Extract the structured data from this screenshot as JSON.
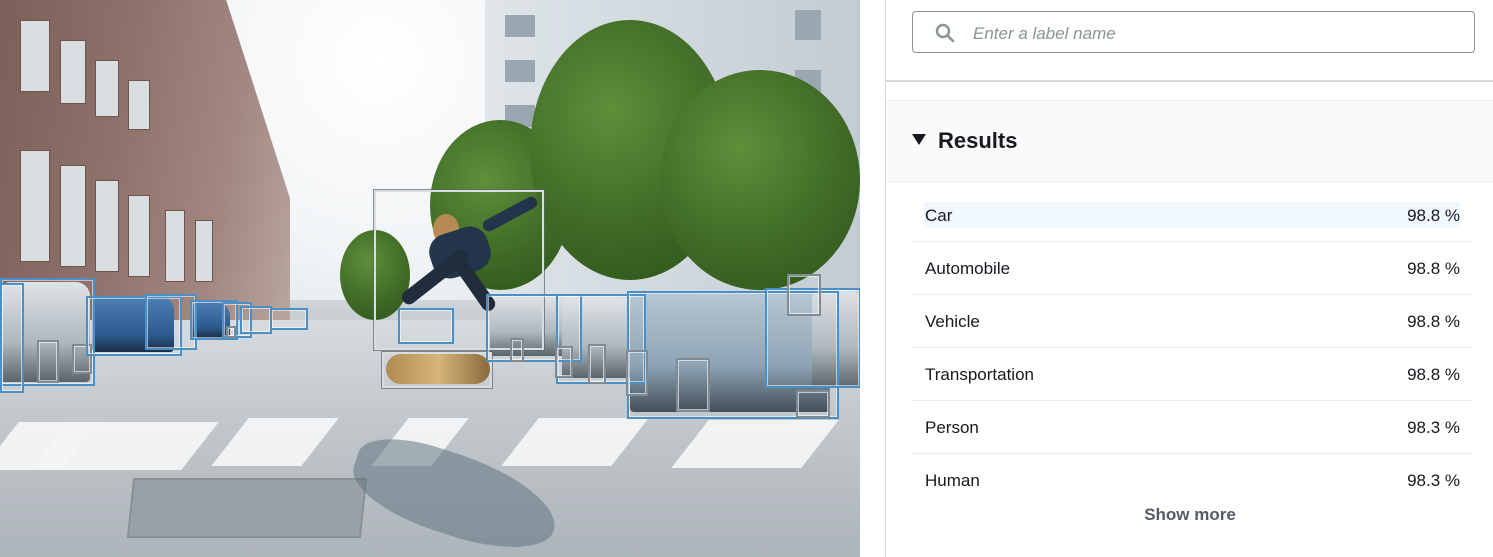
{
  "image": {
    "description_icon": "street-scene-photo"
  },
  "search": {
    "placeholder": "Enter a label name",
    "value": "",
    "icon": "search-icon"
  },
  "results": {
    "title": "Results",
    "toggle_icon": "caret-down-icon",
    "items": [
      {
        "label": "Car",
        "confidence": "98.8 %"
      },
      {
        "label": "Automobile",
        "confidence": "98.8 %"
      },
      {
        "label": "Vehicle",
        "confidence": "98.8 %"
      },
      {
        "label": "Transportation",
        "confidence": "98.8 %"
      },
      {
        "label": "Person",
        "confidence": "98.3 %"
      },
      {
        "label": "Human",
        "confidence": "98.3 %"
      }
    ],
    "show_more_label": "Show more"
  },
  "colors": {
    "bbox_primary": "#4a90c7",
    "bbox_secondary": "#d8dde0",
    "highlight_row": "#f1f8fd",
    "text": "#16191f",
    "muted": "#545b64"
  }
}
